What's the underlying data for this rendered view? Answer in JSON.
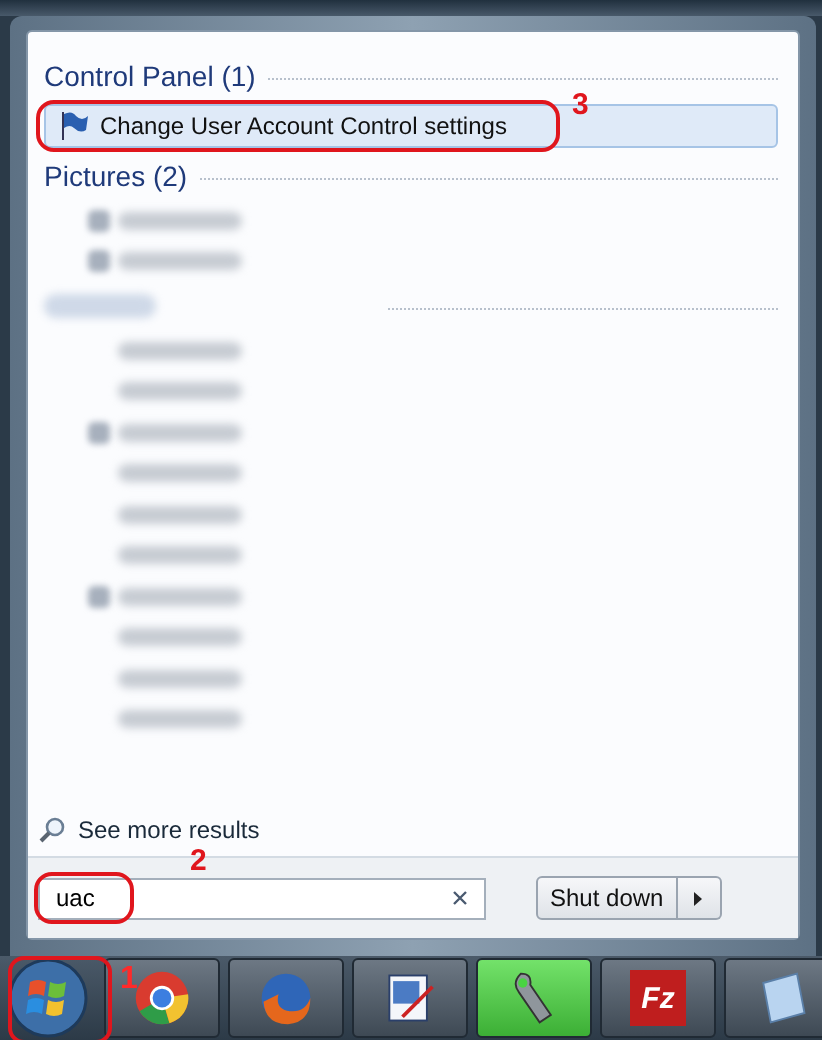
{
  "sections": [
    {
      "kind": "heading",
      "title": "Control Panel (1)",
      "items": [
        {
          "kind": "link",
          "label": "Change User Account Control settings",
          "selected": true,
          "annotation": "3"
        }
      ]
    },
    {
      "kind": "heading",
      "title": "Pictures (2)",
      "items": [
        {
          "kind": "blurred",
          "has_icon": true
        },
        {
          "kind": "blurred",
          "has_icon": true
        }
      ]
    },
    {
      "kind": "blurred-heading",
      "items": [
        {
          "kind": "blurred",
          "has_icon": false
        },
        {
          "kind": "blurred",
          "has_icon": false
        },
        {
          "kind": "blurred",
          "has_icon": true
        },
        {
          "kind": "blurred",
          "has_icon": false
        },
        {
          "kind": "blurred",
          "has_icon": false
        },
        {
          "kind": "blurred",
          "has_icon": false
        },
        {
          "kind": "blurred",
          "has_icon": true
        },
        {
          "kind": "blurred",
          "has_icon": false
        },
        {
          "kind": "blurred",
          "has_icon": false
        },
        {
          "kind": "blurred",
          "has_icon": false
        }
      ]
    }
  ],
  "see_more": "See more results",
  "search": {
    "value": "uac",
    "annotation": "2"
  },
  "shutdown": {
    "label": "Shut down"
  },
  "taskbar": {
    "start_annotation": "1",
    "apps": [
      {
        "kind": "chrome",
        "active": false
      },
      {
        "kind": "firefox",
        "active": false
      },
      {
        "kind": "paint",
        "active": false
      },
      {
        "kind": "wrench",
        "active": true
      },
      {
        "kind": "filezilla",
        "active": false,
        "text": "Fz"
      },
      {
        "kind": "notepad",
        "active": false
      }
    ]
  }
}
